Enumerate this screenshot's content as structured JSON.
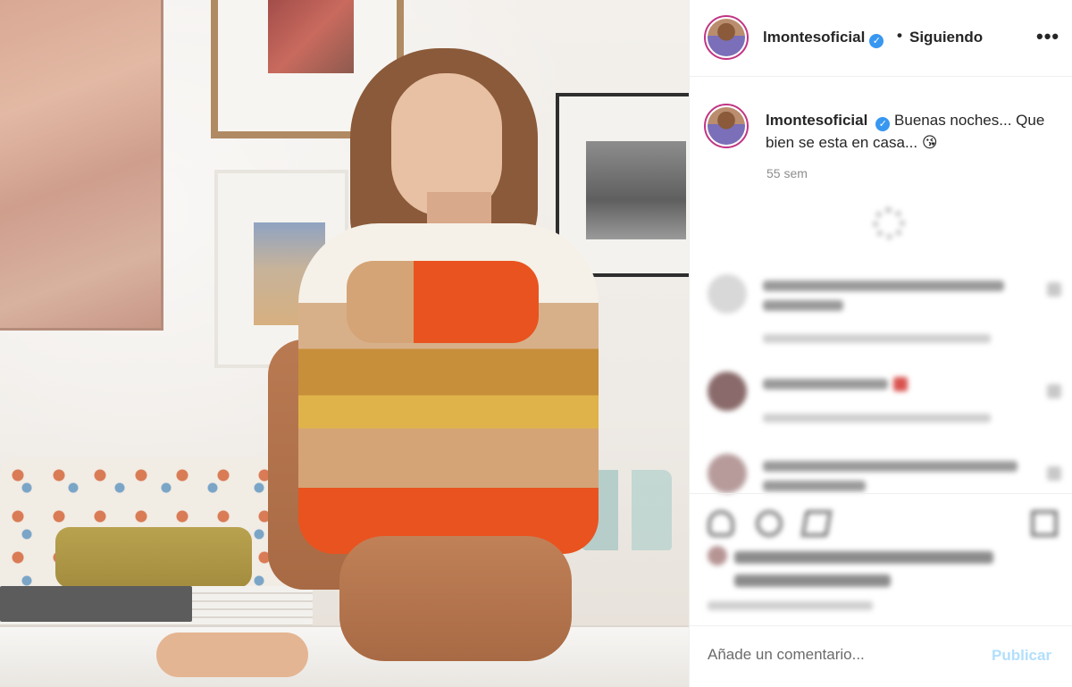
{
  "post": {
    "username": "lmontesoficial",
    "verified_icon": "verified-badge-icon",
    "follow_separator": "•",
    "follow_status": "Siguiendo",
    "more_icon": "•••",
    "caption": "Buenas noches... Que bien se esta en casa... 😘",
    "time_ago": "55 sem"
  },
  "comment_box": {
    "placeholder": "Añade un comentario...",
    "publish_label": "Publicar"
  },
  "colors": {
    "verified": "#3897f0",
    "publish_disabled": "#b2dffc",
    "avatar_ring": "#c13584"
  },
  "icons": [
    "heart-icon",
    "comment-icon",
    "share-icon",
    "save-icon",
    "loading-spinner-icon"
  ]
}
